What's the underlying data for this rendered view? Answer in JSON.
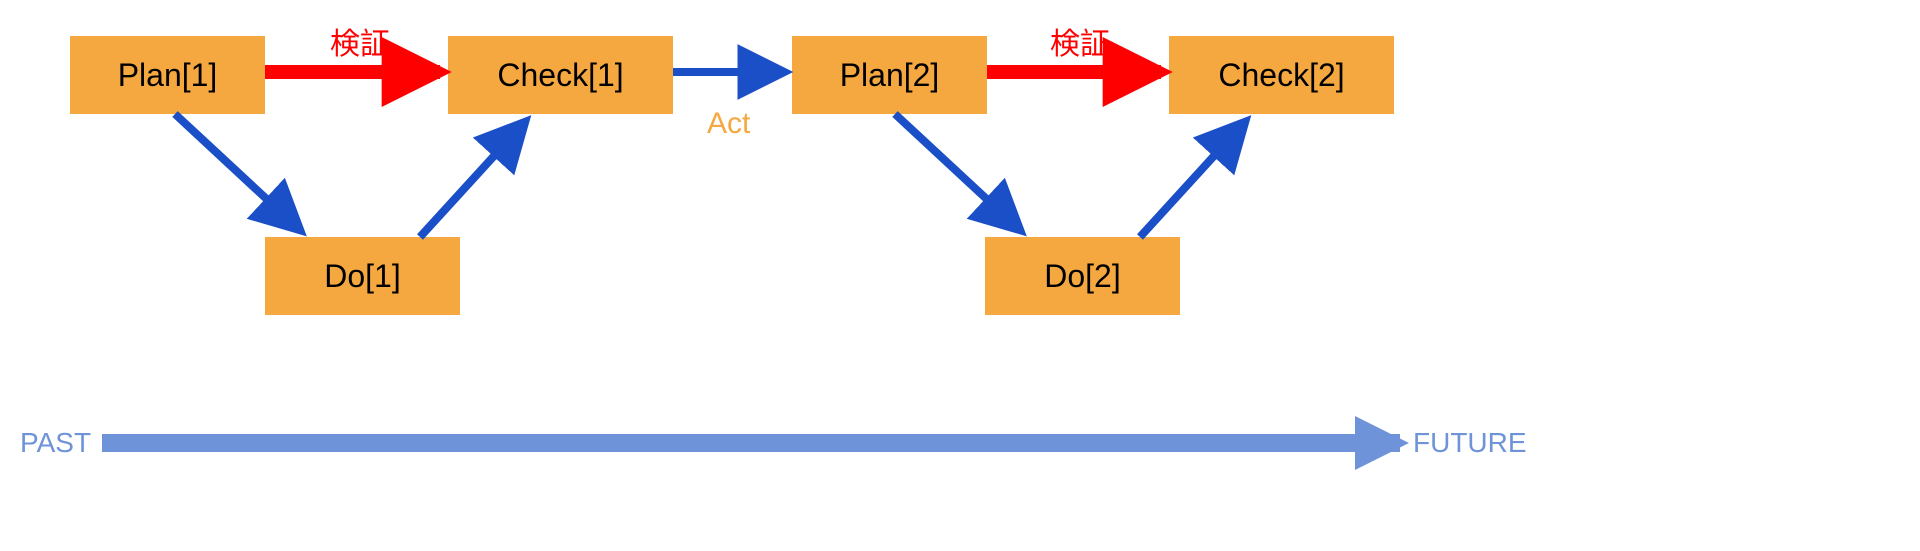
{
  "nodes": {
    "plan1": "Plan[1]",
    "do1": "Do[1]",
    "check1": "Check[1]",
    "plan2": "Plan[2]",
    "do2": "Do[2]",
    "check2": "Check[2]"
  },
  "edge_labels": {
    "verify1": "検証",
    "act": "Act",
    "verify2": "検証"
  },
  "timeline": {
    "past": "PAST",
    "future": "FUTURE"
  },
  "colors": {
    "node_fill": "#f5a840",
    "arrow_blue": "#1a4fc7",
    "arrow_red": "#ff0000",
    "timeline": "#6f93d8",
    "act_text": "#f5a840",
    "verify_text": "#ff0000"
  },
  "chart_data": {
    "type": "diagram",
    "title": "PDCA cycle flow diagram",
    "nodes": [
      {
        "id": "plan1",
        "label": "Plan[1]"
      },
      {
        "id": "do1",
        "label": "Do[1]"
      },
      {
        "id": "check1",
        "label": "Check[1]"
      },
      {
        "id": "plan2",
        "label": "Plan[2]"
      },
      {
        "id": "do2",
        "label": "Do[2]"
      },
      {
        "id": "check2",
        "label": "Check[2]"
      }
    ],
    "edges": [
      {
        "from": "plan1",
        "to": "do1",
        "color": "blue"
      },
      {
        "from": "do1",
        "to": "check1",
        "color": "blue"
      },
      {
        "from": "plan1",
        "to": "check1",
        "color": "red",
        "label": "検証"
      },
      {
        "from": "check1",
        "to": "plan2",
        "color": "blue",
        "label": "Act"
      },
      {
        "from": "plan2",
        "to": "do2",
        "color": "blue"
      },
      {
        "from": "do2",
        "to": "check2",
        "color": "blue"
      },
      {
        "from": "plan2",
        "to": "check2",
        "color": "red",
        "label": "検証"
      }
    ],
    "timeline": {
      "left": "PAST",
      "right": "FUTURE"
    }
  }
}
